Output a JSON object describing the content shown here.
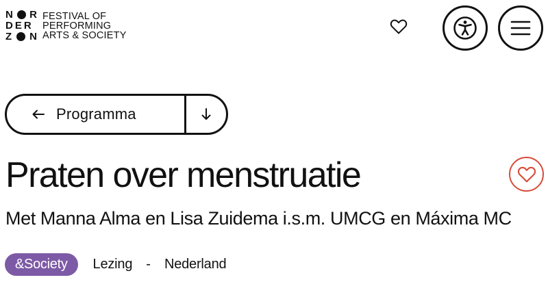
{
  "header": {
    "logo": {
      "row1": [
        "N",
        "R"
      ],
      "row2": "DER",
      "row3": [
        "Z",
        "N"
      ],
      "tagline": [
        "FESTIVAL OF",
        "PERFORMING",
        "ARTS & SOCIETY"
      ]
    },
    "icons": {
      "favorites": "heart-icon",
      "accessibility": "accessibility-icon",
      "menu": "hamburger-menu-icon"
    }
  },
  "nav": {
    "back_label": "Programma",
    "back_icon": "arrow-left-icon",
    "jump_icon": "arrow-down-icon"
  },
  "event": {
    "title": "Praten over menstruatie",
    "subtitle": "Met Manna Alma en Lisa Zuidema i.s.m. UMCG en Máxima MC",
    "category": "&Society",
    "type": "Lezing",
    "separator": "-",
    "country": "Nederland"
  },
  "colors": {
    "accent_red": "#d94b39",
    "category_purple": "#7d5aa6",
    "ink": "#111111"
  }
}
